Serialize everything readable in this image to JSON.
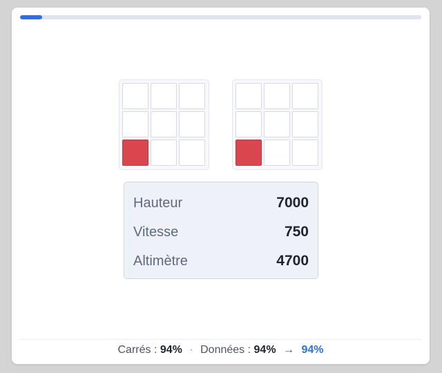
{
  "progress": {
    "fraction": 0.055,
    "color": "#2f6fe4"
  },
  "grids": [
    {
      "rows": 3,
      "cols": 3,
      "active_cell": [
        2,
        0
      ],
      "active_color": "#d9464e"
    },
    {
      "rows": 3,
      "cols": 3,
      "active_cell": [
        2,
        0
      ],
      "active_color": "#d9464e"
    }
  ],
  "data_panel": {
    "rows": [
      {
        "label": "Hauteur",
        "value": "7000"
      },
      {
        "label": "Vitesse",
        "value": "750"
      },
      {
        "label": "Altimètre",
        "value": "4700"
      }
    ]
  },
  "footer": {
    "squares_label": "Carrés :",
    "squares_value": "94%",
    "separator": "·",
    "data_label": "Données :",
    "data_value": "94%",
    "arrow": "→",
    "result_value": "94%",
    "result_color": "#2f6fe4"
  }
}
